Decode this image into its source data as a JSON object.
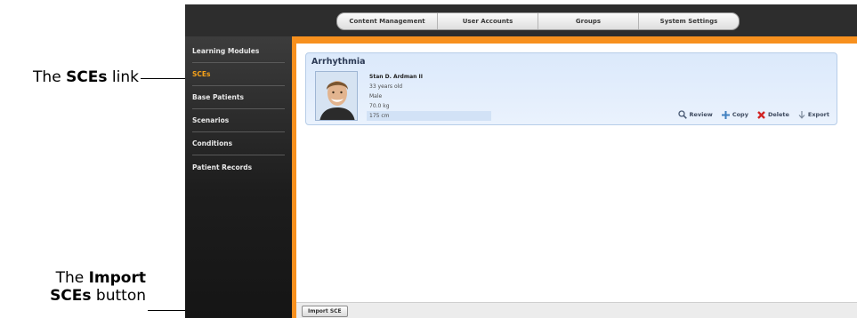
{
  "callouts": {
    "sces_link": {
      "prefix": "The ",
      "bold": "SCEs",
      "suffix": " link"
    },
    "import_button": {
      "line1_prefix": "The ",
      "line1_bold": "Import",
      "line2_bold": "SCEs",
      "line2_suffix": " button"
    }
  },
  "tabs": [
    "Content Management",
    "User Accounts",
    "Groups",
    "System Settings"
  ],
  "sidebar": {
    "items": [
      {
        "label": "Learning Modules",
        "active": false
      },
      {
        "label": "SCEs",
        "active": true
      },
      {
        "label": "Base Patients",
        "active": false
      },
      {
        "label": "Scenarios",
        "active": false
      },
      {
        "label": "Conditions",
        "active": false
      },
      {
        "label": "Patient Records",
        "active": false
      }
    ]
  },
  "sce": {
    "title": "Arrhythmia",
    "patient": {
      "name": "Stan D. Ardman II",
      "age": "33 years old",
      "sex": "Male",
      "weight": "70.0 kg",
      "height": "175 cm"
    },
    "actions": [
      {
        "label": "Review",
        "icon": "magnifier-icon"
      },
      {
        "label": "Copy",
        "icon": "plus-icon"
      },
      {
        "label": "Delete",
        "icon": "x-icon"
      },
      {
        "label": "Export",
        "icon": "download-arrow-icon"
      }
    ]
  },
  "footer": {
    "import_label": "Import SCE"
  },
  "colors": {
    "accent": "#f7901e",
    "active_link": "#f6a21a",
    "card_bg": "#dbe9fb"
  }
}
